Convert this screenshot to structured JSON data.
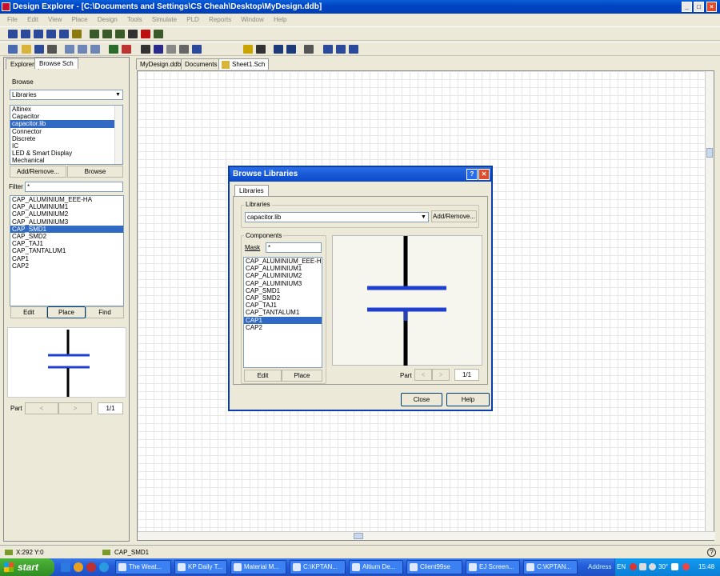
{
  "window": {
    "title": "Design Explorer - [C:\\Documents and Settings\\CS Cheah\\Desktop\\MyDesign.ddb]"
  },
  "menu": [
    "File",
    "Edit",
    "View",
    "Place",
    "Design",
    "Tools",
    "Simulate",
    "PLD",
    "Reports",
    "Window",
    "Help"
  ],
  "left_panel": {
    "tabs": [
      "Explorer",
      "Browse Sch"
    ],
    "browse_label": "Browse",
    "browse_select": "Libraries",
    "libraries": [
      "Altinex",
      "Capacitor",
      "capacitor.lib",
      "Connector",
      "Discrete",
      "IC",
      "LED & Smart Display",
      "Mechanical"
    ],
    "selected_library": "capacitor.lib",
    "add_remove": "Add/Remove...",
    "browse_btn": "Browse",
    "filter_label": "Filter",
    "filter_value": "*",
    "components": [
      "CAP_ALUMINIUM_EEE-HA",
      "CAP_ALUMINIUM1",
      "CAP_ALUMINIUM2",
      "CAP_ALUMINIUM3",
      "CAP_SMD1",
      "CAP_SMD2",
      "CAP_TAJ1",
      "CAP_TANTALUM1",
      "CAP1",
      "CAP2"
    ],
    "selected_component": "CAP_SMD1",
    "edit_btn": "Edit",
    "place_btn": "Place",
    "find_btn": "Find",
    "part_label": "Part",
    "part_value": "1/1"
  },
  "doc_tabs": [
    "MyDesign.ddb",
    "Documents",
    "Sheet1.Sch"
  ],
  "dialog": {
    "title": "Browse Libraries",
    "help_glyph": "?",
    "close_glyph": "✕",
    "tab": "Libraries",
    "libraries_group": "Libraries",
    "library_value": "capacitor.lib",
    "add_remove": "Add/Remove...",
    "components_group": "Components",
    "mask_label": "Mask",
    "mask_value": "*",
    "components": [
      "CAP_ALUMINIUM_EEE-HA",
      "CAP_ALUMINIUM1",
      "CAP_ALUMINIUM2",
      "CAP_ALUMINIUM3",
      "CAP_SMD1",
      "CAP_SMD2",
      "CAP_TAJ1",
      "CAP_TANTALUM1",
      "CAP1",
      "CAP2"
    ],
    "selected_component": "CAP1",
    "edit_btn": "Edit",
    "place_btn": "Place",
    "part_label": "Part",
    "part_value": "1/1",
    "close_btn": "Close",
    "help_btn": "Help"
  },
  "status_bar": {
    "coords": "X:292 Y:0",
    "component": "CAP_SMD1"
  },
  "taskbar": {
    "start": "start",
    "tasks": [
      "The Weat...",
      "KP Daily T...",
      "Material M...",
      "C:\\KPTAN...",
      "Altium De...",
      "Client99se",
      "EJ Screen...",
      "C:\\KPTAN..."
    ],
    "address_label": "Address",
    "language": "EN",
    "temperature": "30°",
    "clock": "15:48"
  },
  "colors": {
    "title_blue": "#0045c4",
    "selection": "#316ac5",
    "capacitor_plate": "#1f3fd0",
    "capacitor_lead": "#000000"
  }
}
